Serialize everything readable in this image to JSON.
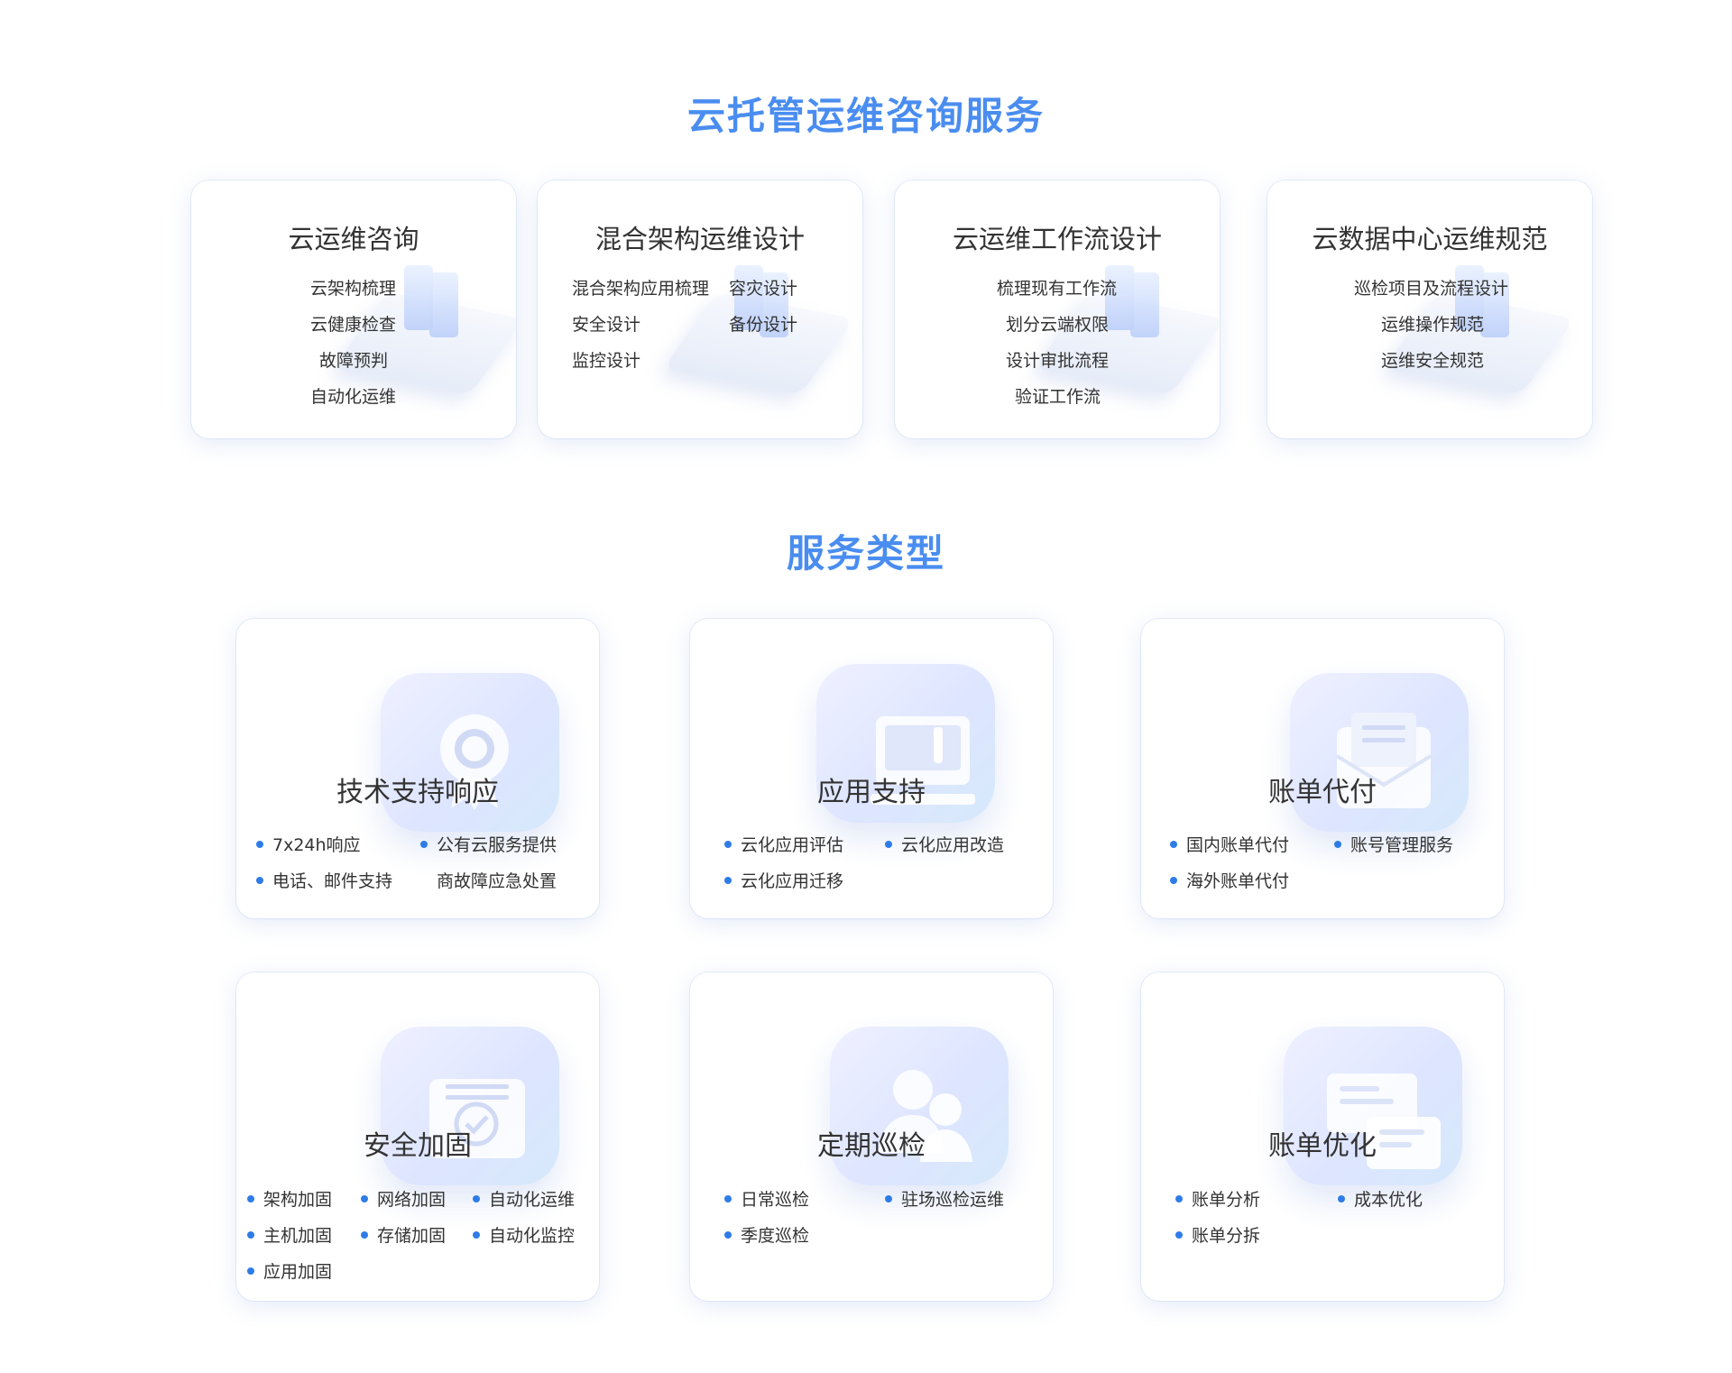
{
  "consulting": {
    "title": "云托管运维咨询服务",
    "cards": [
      {
        "title": "云运维咨询",
        "items": [
          "云架构梳理",
          "云健康检查",
          "故障预判",
          "自动化运维"
        ]
      },
      {
        "title": "混合架构运维设计",
        "items": [
          "混合架构应用梳理",
          "容灾设计",
          "安全设计",
          "备份设计",
          "监控设计"
        ]
      },
      {
        "title": "云运维工作流设计",
        "items": [
          "梳理现有工作流",
          "划分云端权限",
          "设计审批流程",
          "验证工作流"
        ]
      },
      {
        "title": "云数据中心运维规范",
        "items": [
          "巡检项目及流程设计",
          "运维操作规范",
          "运维安全规范"
        ]
      }
    ]
  },
  "services": {
    "title": "服务类型",
    "cards": [
      {
        "title": "技术支持响应",
        "icon": "award-badge-icon",
        "items": [
          "7x24h响应",
          "公有云服务提供",
          "电话、邮件支持",
          "商故障应急处置"
        ]
      },
      {
        "title": "应用支持",
        "icon": "computer-monitor-icon",
        "items": [
          "云化应用评估",
          "云化应用改造",
          "云化应用迁移"
        ]
      },
      {
        "title": "账单代付",
        "icon": "envelope-icon",
        "items": [
          "国内账单代付",
          "账号管理服务",
          "海外账单代付"
        ]
      },
      {
        "title": "安全加固",
        "icon": "secure-envelope-check-icon",
        "items": [
          "架构加固",
          "网络加固",
          "自动化运维",
          "主机加固",
          "存储加固",
          "自动化监控",
          "应用加固"
        ]
      },
      {
        "title": "定期巡检",
        "icon": "users-icon",
        "items": [
          "日常巡检",
          "驻场巡检运维",
          "季度巡检"
        ]
      },
      {
        "title": "账单优化",
        "icon": "chat-bubbles-icon",
        "items": [
          "账单分析",
          "成本优化",
          "账单分拆"
        ]
      }
    ]
  },
  "colors": {
    "accent": "#4a8df0",
    "bullet": "#2f7ce8",
    "text": "#333333"
  }
}
